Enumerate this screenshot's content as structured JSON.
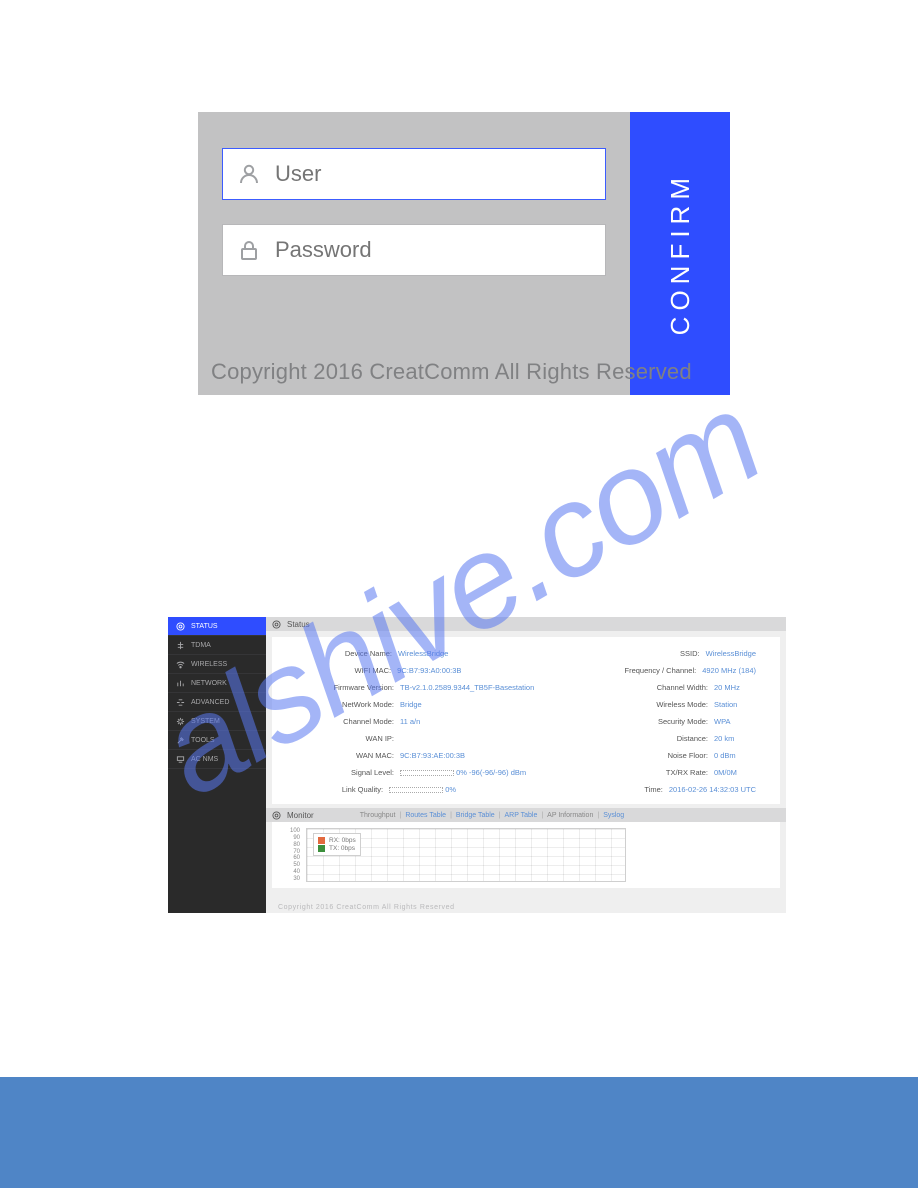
{
  "watermark": "  alshive.com",
  "login": {
    "user_placeholder": "User",
    "password_placeholder": "Password",
    "confirm": "CONFIRM",
    "copyright": "Copyright 2016 CreatComm All Rights Reserved"
  },
  "sidebar": {
    "items": [
      {
        "label": "STATUS"
      },
      {
        "label": "TDMA"
      },
      {
        "label": "WIRELESS"
      },
      {
        "label": "NETWORK"
      },
      {
        "label": "ADVANCED"
      },
      {
        "label": "SYSTEM"
      },
      {
        "label": "TOOLS"
      },
      {
        "label": "AC NMS"
      }
    ]
  },
  "status": {
    "title": "Status",
    "rows": [
      {
        "l1": "Device Name:",
        "v1": "WirelessBridge",
        "l2": "SSID:",
        "v2": "WirelessBridge"
      },
      {
        "l1": "WIFI MAC:",
        "v1": "9C:B7:93:A0:00:3B",
        "l2": "Frequency / Channel:",
        "v2": "4920 MHz (184)"
      },
      {
        "l1": "Firmware Version:",
        "v1": "TB-v2.1.0.2589.9344_TB5F-Basestation",
        "l2": "Channel Width:",
        "v2": "20 MHz"
      },
      {
        "l1": "NetWork Mode:",
        "v1": "Bridge",
        "l2": "Wireless Mode:",
        "v2": "Station"
      },
      {
        "l1": "Channel Mode:",
        "v1": "11 a/n",
        "l2": "Security Mode:",
        "v2": "WPA"
      },
      {
        "l1": "WAN IP:",
        "v1": "",
        "l2": "Distance:",
        "v2": "20 km"
      },
      {
        "l1": "WAN MAC:",
        "v1": "9C:B7:93:AE:00:3B",
        "l2": "Noise Floor:",
        "v2": "0 dBm"
      },
      {
        "l1": "Signal Level:",
        "v1": "__BAR__ 0%   -96(-96/-96) dBm",
        "l2": "TX/RX Rate:",
        "v2": "0M/0M"
      },
      {
        "l1": "Link Quality:",
        "v1": "__BAR__ 0%",
        "l2": "Time:",
        "v2": "2016-02-26 14:32:03 UTC"
      }
    ]
  },
  "monitor": {
    "title": "Monitor",
    "tabs": [
      "Throughput",
      "Routes Table",
      "Bridge Table",
      "ARP Table",
      "AP Information",
      "Syslog"
    ],
    "legend_rx": "RX: 0bps",
    "legend_tx": "TX: 0bps"
  },
  "dash_copyright": "Copyright 2016 CreatComm All Rights Reserved",
  "chart_data": {
    "type": "line",
    "title": "Throughput",
    "ylabel": "",
    "ylim": [
      0,
      100
    ],
    "y_ticks": [
      100,
      90,
      80,
      70,
      60,
      50,
      40,
      30
    ],
    "series": [
      {
        "name": "RX",
        "unit": "bps",
        "values": [
          0
        ]
      },
      {
        "name": "TX",
        "unit": "bps",
        "values": [
          0
        ]
      }
    ]
  }
}
